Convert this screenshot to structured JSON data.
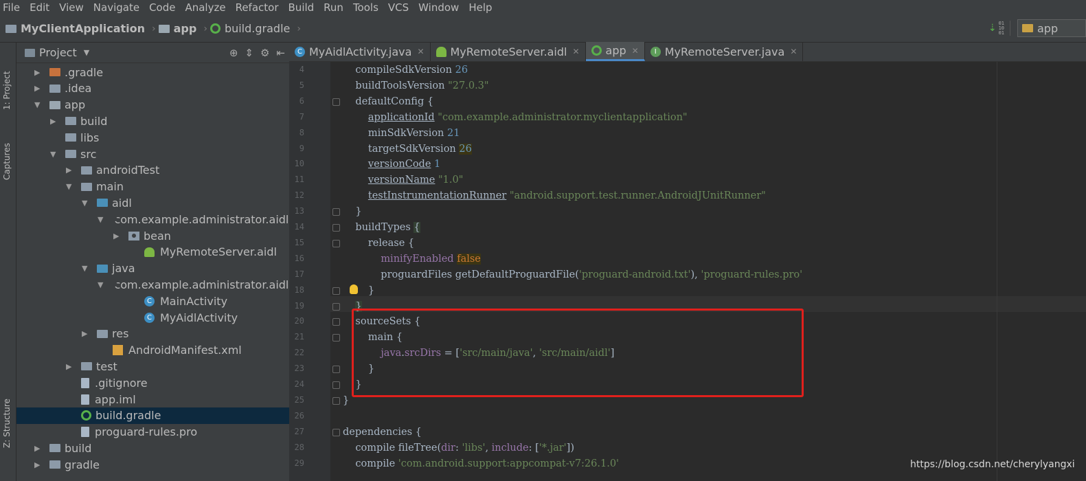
{
  "menu": [
    "File",
    "Edit",
    "View",
    "Navigate",
    "Code",
    "Analyze",
    "Refactor",
    "Build",
    "Run",
    "Tools",
    "VCS",
    "Window",
    "Help"
  ],
  "breadcrumb": {
    "project": "MyClientApplication",
    "module": "app",
    "file": "build.gradle"
  },
  "config_selector": "app",
  "sidebar_tabs": {
    "project": "1: Project",
    "captures": "Captures",
    "structure": "Z: Structure"
  },
  "project_panel": {
    "title": "Project"
  },
  "tree": [
    {
      "label": ".gradle",
      "indent": 0,
      "arrow": "▶",
      "icon": "folder-orange"
    },
    {
      "label": ".idea",
      "indent": 0,
      "arrow": "▶",
      "icon": "folder"
    },
    {
      "label": "app",
      "indent": 0,
      "arrow": "▼",
      "icon": "folder-plain"
    },
    {
      "label": "build",
      "indent": 1,
      "arrow": "▶",
      "icon": "folder"
    },
    {
      "label": "libs",
      "indent": 1,
      "arrow": "",
      "icon": "folder"
    },
    {
      "label": "src",
      "indent": 1,
      "arrow": "▼",
      "icon": "folder"
    },
    {
      "label": "androidTest",
      "indent": 2,
      "arrow": "▶",
      "icon": "folder"
    },
    {
      "label": "main",
      "indent": 2,
      "arrow": "▼",
      "icon": "folder"
    },
    {
      "label": "aidl",
      "indent": 3,
      "arrow": "▼",
      "icon": "folder-blue"
    },
    {
      "label": "com.example.administrator.aidls",
      "indent": 4,
      "arrow": "▼",
      "icon": "package"
    },
    {
      "label": "bean",
      "indent": 5,
      "arrow": "▶",
      "icon": "package"
    },
    {
      "label": "MyRemoteServer.aidl",
      "indent": 6,
      "arrow": "",
      "icon": "android"
    },
    {
      "label": "java",
      "indent": 3,
      "arrow": "▼",
      "icon": "folder-blue"
    },
    {
      "label": "com.example.administrator.aidls",
      "indent": 4,
      "arrow": "▼",
      "icon": "package"
    },
    {
      "label": "MainActivity",
      "indent": 6,
      "arrow": "",
      "icon": "class"
    },
    {
      "label": "MyAidlActivity",
      "indent": 6,
      "arrow": "",
      "icon": "class"
    },
    {
      "label": "res",
      "indent": 3,
      "arrow": "▶",
      "icon": "folder"
    },
    {
      "label": "AndroidManifest.xml",
      "indent": 4,
      "arrow": "",
      "icon": "xml"
    },
    {
      "label": "test",
      "indent": 2,
      "arrow": "▶",
      "icon": "folder"
    },
    {
      "label": ".gitignore",
      "indent": 2,
      "arrow": "",
      "icon": "file"
    },
    {
      "label": "app.iml",
      "indent": 2,
      "arrow": "",
      "icon": "file"
    },
    {
      "label": "build.gradle",
      "indent": 2,
      "arrow": "",
      "icon": "gradle",
      "selected": true
    },
    {
      "label": "proguard-rules.pro",
      "indent": 2,
      "arrow": "",
      "icon": "file"
    },
    {
      "label": "build",
      "indent": 0,
      "arrow": "▶",
      "icon": "folder"
    },
    {
      "label": "gradle",
      "indent": 0,
      "arrow": "▶",
      "icon": "folder"
    }
  ],
  "tabs": [
    {
      "label": "MyAidlActivity.java",
      "icon": "class"
    },
    {
      "label": "MyRemoteServer.aidl",
      "icon": "android"
    },
    {
      "label": "app",
      "icon": "gradle",
      "active": true
    },
    {
      "label": "MyRemoteServer.java",
      "icon": "interface"
    }
  ],
  "code": [
    {
      "n": "4",
      "html": "    compileSdkVersion <span class=\"num\">26</span>"
    },
    {
      "n": "5",
      "html": "    buildToolsVersion <span class=\"str\">\"27.0.3\"</span>"
    },
    {
      "n": "6",
      "html": "    defaultConfig {"
    },
    {
      "n": "7",
      "html": "        <span class=\"ul\">applicationId</span> <span class=\"str\">\"com.example.administrator.myclientapplication\"</span>"
    },
    {
      "n": "8",
      "html": "        minSdkVersion <span class=\"num\">21</span>"
    },
    {
      "n": "9",
      "html": "        targetSdkVersion <span class=\"num fl\">26</span>"
    },
    {
      "n": "10",
      "html": "        <span class=\"ul\">versionCode</span> <span class=\"num\">1</span>"
    },
    {
      "n": "11",
      "html": "        <span class=\"ul\">versionName</span> <span class=\"str\">\"1.0\"</span>"
    },
    {
      "n": "12",
      "html": "        <span class=\"ul\">testInstrumentationRunner</span> <span class=\"str\">\"android.support.test.runner.AndroidJUnitRunner\"</span>"
    },
    {
      "n": "13",
      "html": "    }"
    },
    {
      "n": "14",
      "html": "    buildTypes <span class=\"hl\">{</span>"
    },
    {
      "n": "15",
      "html": "        release {"
    },
    {
      "n": "16",
      "html": "            <span class=\"prop\">minifyEnabled</span> <span class=\"kw fl\">false</span>"
    },
    {
      "n": "17",
      "html": "            proguardFiles getDefaultProguardFile(<span class=\"str\">'proguard-android.txt'</span>), <span class=\"str\">'proguard-rules.pro'</span>"
    },
    {
      "n": "18",
      "html": "        }"
    },
    {
      "n": "19",
      "html": "    <span class=\"hl\">}</span>"
    },
    {
      "n": "20",
      "html": "    sourceSets {"
    },
    {
      "n": "21",
      "html": "        main {"
    },
    {
      "n": "22",
      "html": "            <span class=\"prop\">java</span>.<span class=\"prop\">srcDirs</span> = [<span class=\"str\">'src/main/java'</span>, <span class=\"str\">'src/main/aidl'</span>]"
    },
    {
      "n": "23",
      "html": "        }"
    },
    {
      "n": "24",
      "html": "    }"
    },
    {
      "n": "25",
      "html": "}"
    },
    {
      "n": "26",
      "html": ""
    },
    {
      "n": "27",
      "html": "dependencies {"
    },
    {
      "n": "28",
      "html": "    compile fileTree(<span class=\"prop\">dir</span>: <span class=\"str\">'libs'</span>, <span class=\"prop\">include</span>: [<span class=\"str\">'*.jar'</span>])"
    },
    {
      "n": "29",
      "html": "    compile <span class=\"str\">'com.android.support:appcompat-v7:26.1.0'</span>"
    }
  ],
  "watermark": "https://blog.csdn.net/cherylyangxi"
}
